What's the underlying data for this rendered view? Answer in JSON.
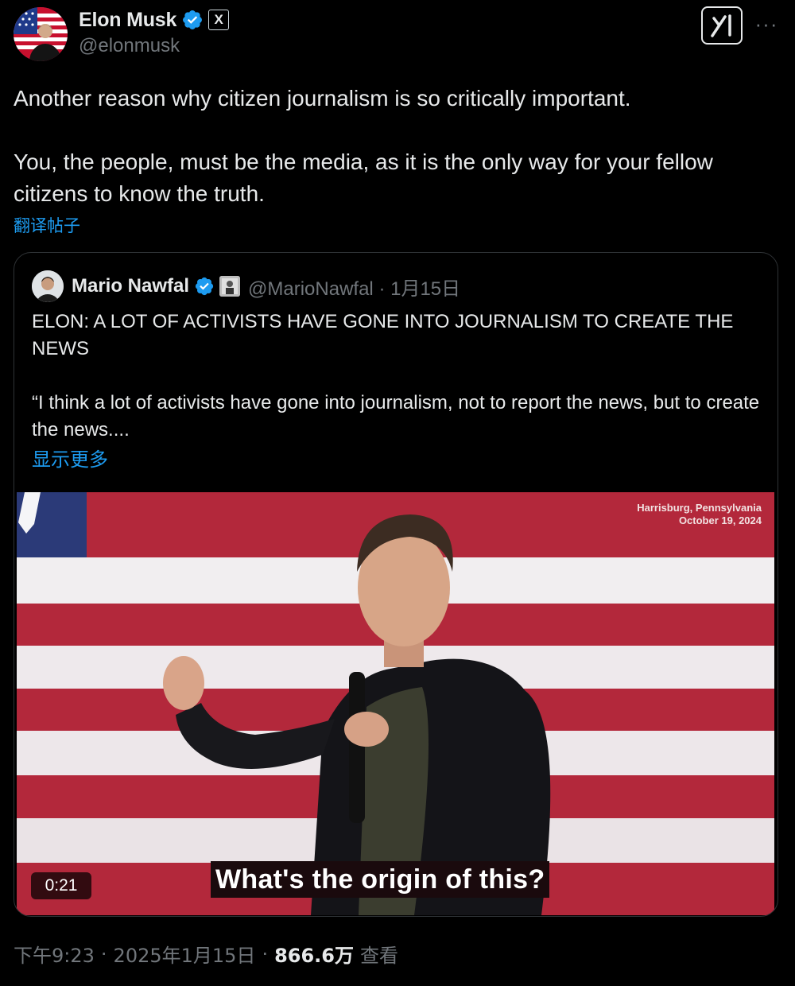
{
  "author": {
    "name": "Elon Musk",
    "handle": "@elonmusk",
    "affiliation_badge": "X"
  },
  "tweet": {
    "line1": "Another reason why citizen journalism is so critically important.",
    "line2": "You, the people, must be the media, as it is the only way for your fellow citizens to know the truth.",
    "translate_label": "翻译帖子"
  },
  "quote": {
    "name": "Mario Nawfal",
    "handle": "@MarioNawfal",
    "separator": "·",
    "date": "1月15日",
    "headline": "ELON: A LOT OF ACTIVISTS HAVE GONE INTO JOURNALISM TO CREATE THE NEWS",
    "body": "“I think a lot of activists have gone into journalism, not to report the news, but to create the news....",
    "show_more_label": "显示更多"
  },
  "video": {
    "location": "Harrisburg, Pennsylvania",
    "date": "October 19, 2024",
    "duration": "0:21",
    "caption": "What's the origin of this?"
  },
  "meta": {
    "time": "下午9:23",
    "sep1": "·",
    "date": "2025年1月15日",
    "sep2": "·",
    "views": "866.6万",
    "views_label": "查看"
  },
  "colors": {
    "background": "#000000",
    "text": "#e7e9ea",
    "muted": "#71767b",
    "link": "#1d9bf0",
    "verified": "#1d9bf0",
    "border": "#2f3336"
  },
  "icons": [
    "verified-badge-icon",
    "x-logo-icon",
    "grok-icon",
    "more-icon"
  ]
}
